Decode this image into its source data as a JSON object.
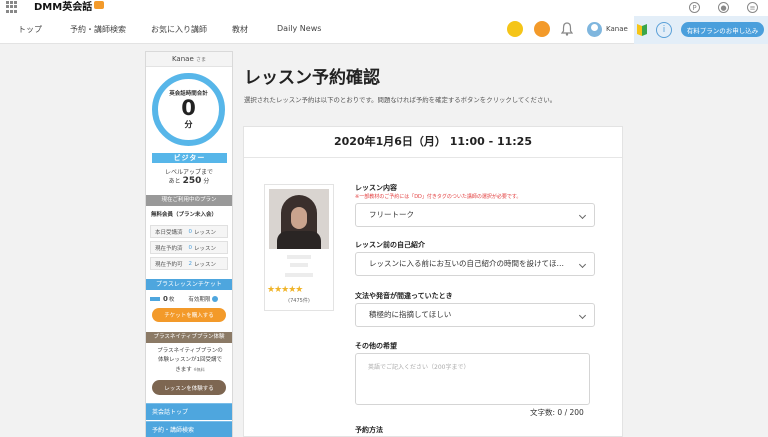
{
  "brand": {
    "logo_text": "DMM英会話"
  },
  "nav": {
    "items": [
      "トップ",
      "予約・講師検索",
      "お気に入り講師",
      "教材",
      "Daily News"
    ],
    "user": "Kanae",
    "trial_button": "有料プランのお申し込み"
  },
  "sidebar": {
    "name": "Kanae",
    "honorific": "さま",
    "total_label": "英会話時間合計",
    "total_minutes": "0",
    "minutes_unit": "分",
    "rank": "ビジター",
    "levelup_line1": "レベルアップまで",
    "levelup_prefix": "あと",
    "levelup_value": "250",
    "levelup_unit": "分",
    "plan_heading": "現在ご利用中のプラン",
    "plan_name": "無料会員（プラン未入会）",
    "stats": [
      {
        "label": "本日受講済",
        "value": "0",
        "unit": "レッスン"
      },
      {
        "label": "現在予約済",
        "value": "0",
        "unit": "レッスン"
      },
      {
        "label": "現在予約可",
        "value": "2",
        "unit": "レッスン"
      }
    ],
    "ticket_heading": "プラスレッスンチケット",
    "ticket_count": "0",
    "ticket_unit": "枚",
    "ticket_hint": "有効期限",
    "buy_button": "チケットを購入する",
    "native_heading": "プラスネイティブプラン体験",
    "native_text_1": "プラスネイティブプランの",
    "native_text_2": "体験レッスンが1回受講で",
    "native_text_3": "きます",
    "native_text_small": "※無料",
    "try_button": "レッスンを体験する",
    "links": [
      "英会話トップ",
      "予約・講師検索"
    ]
  },
  "main": {
    "title": "レッスン予約確認",
    "subtitle": "選択されたレッスン予約は以下のとおりです。問題なければ予約を確定するボタンをクリックしてください。",
    "datetime": "2020年1月6日（月） 11:00 - 11:25",
    "teacher": {
      "stars": "★★★★★",
      "reviews": "(7475件)"
    },
    "fields": {
      "content_label": "レッスン内容",
      "content_note": "※一部教材のご予約には「DD」付きタグのついた講師の選択が必要です。",
      "content_value": "フリートーク",
      "intro_label": "レッスン前の自己紹介",
      "intro_value": "レッスンに入る前にお互いの自己紹介の時間を設けてほしい",
      "correction_label": "文法や発音が間違っていたとき",
      "correction_value": "積極的に指摘してほしい",
      "other_label": "その他の希望",
      "other_placeholder": "英語でご記入ください（200字まで）",
      "char_count": "文字数: 0 / 200",
      "method_label": "予約方法"
    }
  }
}
